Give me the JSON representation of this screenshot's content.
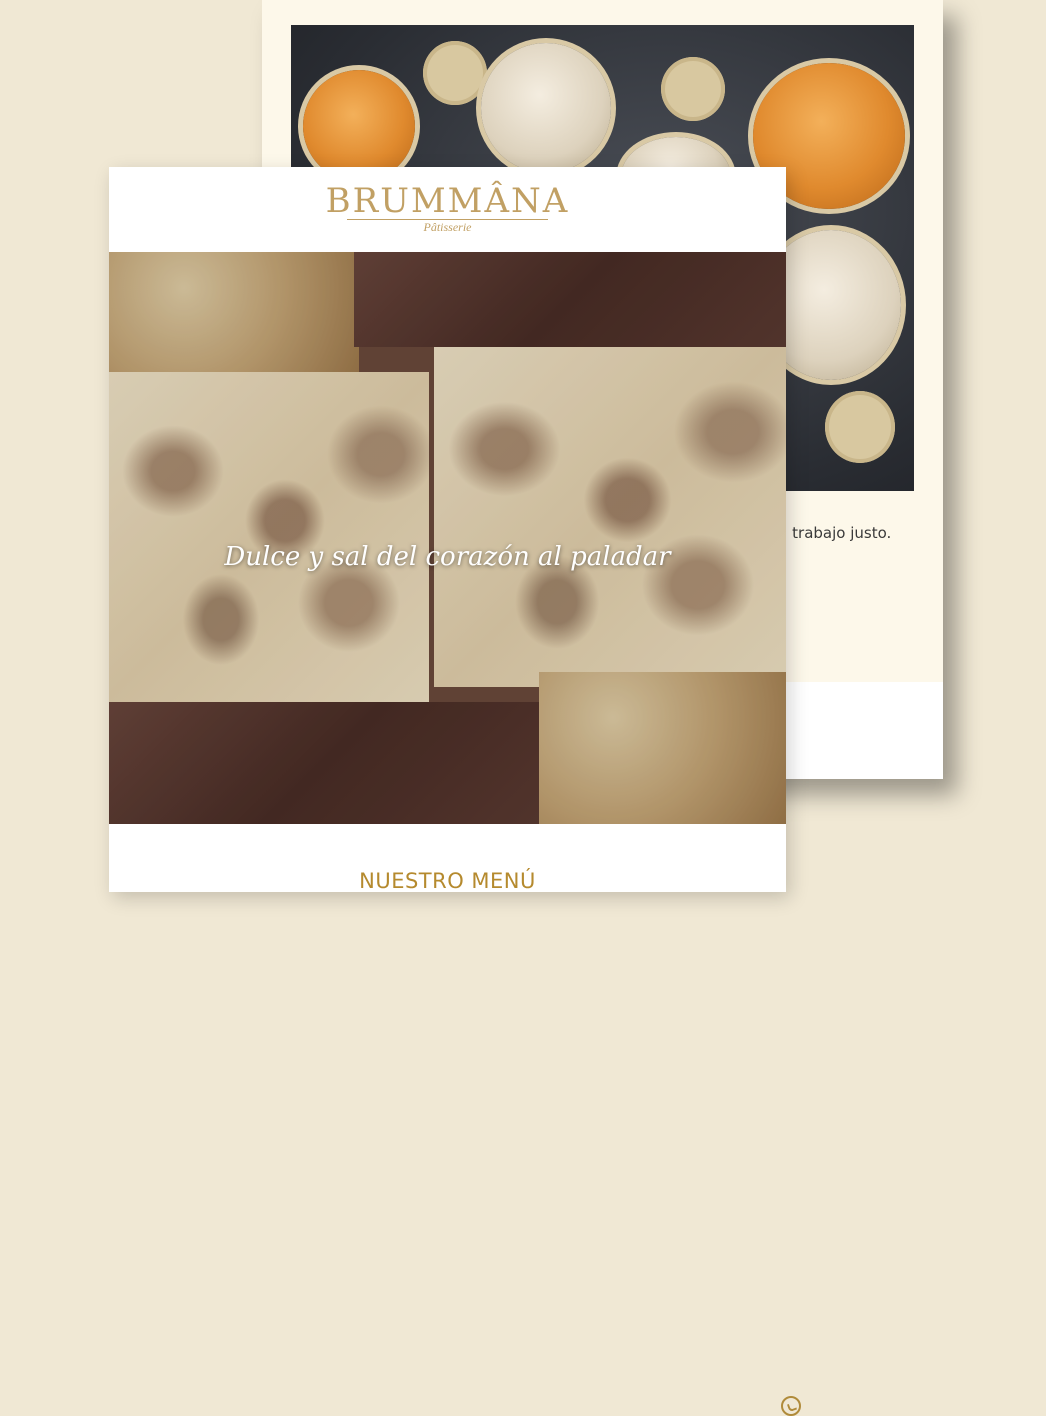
{
  "back_card": {
    "text_fragment": "el trabajo justo."
  },
  "front_card": {
    "logo": {
      "brand": "BRUMMÂNA",
      "subtitle": "Pâtisserie"
    },
    "hero": {
      "tagline": "Dulce y sal del corazón al paladar"
    },
    "menu_heading": "NUESTRO MENÚ"
  },
  "colors": {
    "background": "#f0e8d4",
    "accent_gold": "#b58a2e",
    "logo_gold": "#c1a064"
  }
}
